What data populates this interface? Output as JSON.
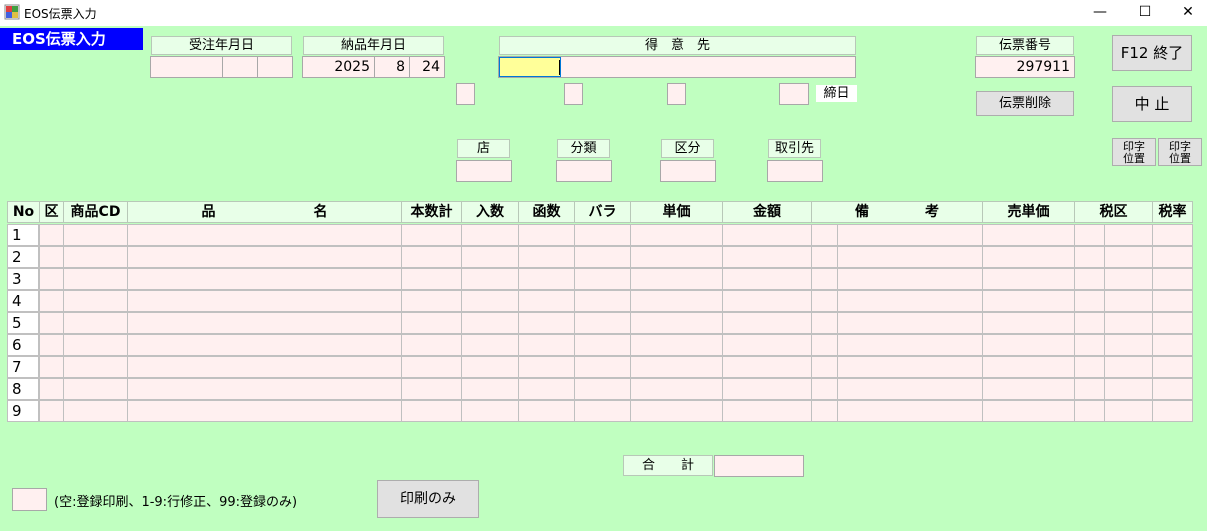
{
  "window": {
    "title": "EOS伝票入力",
    "minimize": "—",
    "maximize": "☐",
    "close": "✕"
  },
  "header": {
    "screen_label": "EOS伝票入力",
    "order_date_label": "受注年月日",
    "delivery_date_label": "納品年月日",
    "delivery_year": "2025",
    "delivery_month": "8",
    "delivery_day": "24",
    "customer_label": "得　意　先",
    "closing_day_label": "締日",
    "slip_number_label": "伝票番号",
    "slip_number": "297911",
    "delete_slip_button": "伝票削除",
    "f12_exit_button": "F12 終了",
    "cancel_button": "中 止",
    "print_position_1": "印字\n位置",
    "print_position_2": "印字\n位置"
  },
  "codes": {
    "store_label": "店",
    "category_label": "分類",
    "division_label": "区分",
    "trade_partner_label": "取引先"
  },
  "table": {
    "columns": [
      "No",
      "区",
      "商品CD",
      "品　　　　　　　名",
      "本数計",
      "入数",
      "函数",
      "バラ",
      "単価",
      "金額",
      "備　　　　考",
      "売単価",
      "税区",
      "税率"
    ],
    "rows": [
      "1",
      "2",
      "3",
      "4",
      "5",
      "6",
      "7",
      "8",
      "9"
    ]
  },
  "footer": {
    "total_label": "合　　計",
    "mode_hint": "(空:登録印刷、1-9:行修正、99:登録のみ)",
    "print_only_button": "印刷のみ"
  }
}
